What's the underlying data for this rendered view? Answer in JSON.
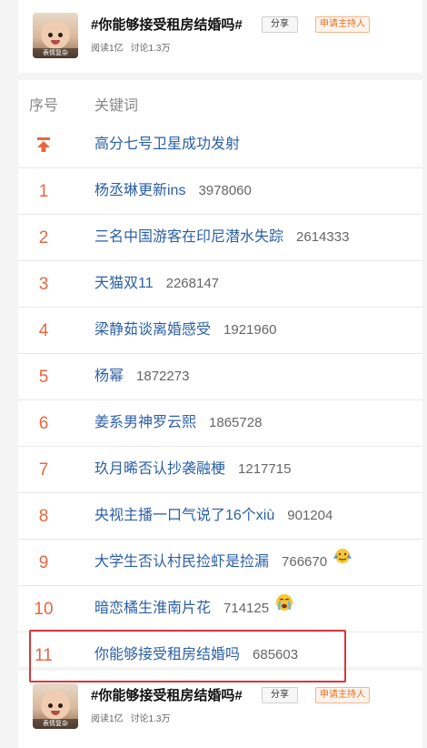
{
  "topic": {
    "title": "#你能够接受租房结婚吗#",
    "reads": "阅读1亿",
    "discussions": "讨论1.3万",
    "share_label": "分享",
    "host_label": "申请主持人",
    "avatar_caption": "表情复杂"
  },
  "list": {
    "col_rank": "序号",
    "col_keyword": "关键词",
    "top_row": {
      "keyword": "高分七号卫星成功发射",
      "icon": "pin-top-icon"
    },
    "rows": [
      {
        "rank": "1",
        "keyword": "杨丞琳更新ins",
        "count": "3978060"
      },
      {
        "rank": "2",
        "keyword": "三名中国游客在印尼潜水失踪",
        "count": "2614333"
      },
      {
        "rank": "3",
        "keyword": "天猫双11",
        "count": "2268147"
      },
      {
        "rank": "4",
        "keyword": "梁静茹谈离婚感受",
        "count": "1921960"
      },
      {
        "rank": "5",
        "keyword": "杨幂",
        "count": "1872273"
      },
      {
        "rank": "6",
        "keyword": "姜系男神罗云熙",
        "count": "1865728"
      },
      {
        "rank": "7",
        "keyword": "玖月晞否认抄袭融梗",
        "count": "1217715"
      },
      {
        "rank": "8",
        "keyword": "央视主播一口气说了16个xiù",
        "count": "901204"
      },
      {
        "rank": "9",
        "keyword": "大学生否认村民捡虾是捡漏",
        "count": "766670",
        "emoji": "shrug-emoji-icon"
      },
      {
        "rank": "10",
        "keyword": "暗恋橘生淮南片花",
        "count": "714125",
        "emoji": "crying-emoji-icon"
      },
      {
        "rank": "11",
        "keyword": "你能够接受租房结婚吗",
        "count": "685603"
      }
    ]
  },
  "colors": {
    "rank": "#e8673f",
    "keyword": "#2b5fa6",
    "highlight": "#d9373a",
    "host": "#e3721f"
  }
}
